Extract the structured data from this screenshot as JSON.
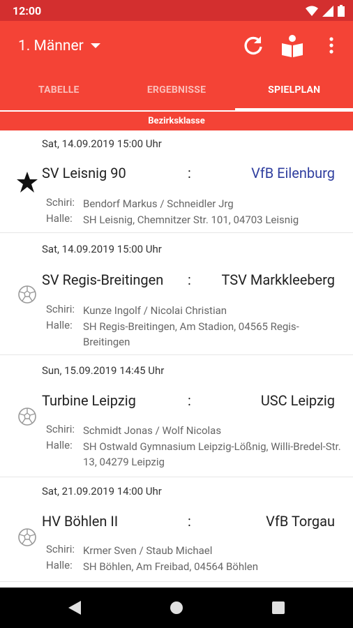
{
  "status": {
    "time": "12:00"
  },
  "app_bar": {
    "title": "1. Männer"
  },
  "tabs": [
    {
      "label": "TABELLE"
    },
    {
      "label": "ERGEBNISSE"
    },
    {
      "label": "SPIELPLAN"
    }
  ],
  "section": {
    "title": "Bezirksklasse"
  },
  "detail_labels": {
    "referee": "Schiri:",
    "hall": "Halle:"
  },
  "matches": [
    {
      "date": "Sat, 14.09.2019 15:00 Uhr",
      "icon": "star-icon",
      "home": "SV Leisnig 90",
      "sep": ":",
      "away": "VfB Eilenburg",
      "referee": "Bendorf Markus / Schneidler Jrg",
      "hall": "SH Leisnig, Chemnitzer Str. 101, 04703 Leisnig"
    },
    {
      "date": "Sat, 14.09.2019 15:00 Uhr",
      "icon": "handball-icon",
      "home": "SV Regis-Breitingen",
      "sep": ":",
      "away": "TSV Markkleeberg",
      "referee": "Kunze Ingolf / Nicolai Christian",
      "hall": "SH Regis-Breitingen, Am Stadion, 04565 Regis-Breitingen"
    },
    {
      "date": "Sun, 15.09.2019 14:45 Uhr",
      "icon": "handball-icon",
      "home": "Turbine Leipzig",
      "sep": ":",
      "away": "USC Leipzig",
      "referee": "Schmidt Jonas / Wolf Nicolas",
      "hall": "SH Ostwald Gymnasium Leipzig-Lößnig, Willi-Bredel-Str. 13, 04279 Leipzig"
    },
    {
      "date": "Sat, 21.09.2019 14:00 Uhr",
      "icon": "handball-icon",
      "home": "HV Böhlen II",
      "sep": ":",
      "away": "VfB Torgau",
      "referee": "Krmer Sven / Staub Michael",
      "hall": "SH Böhlen, Am Freibad, 04564 Böhlen"
    }
  ],
  "colors": {
    "primary": "#f44336",
    "status_bar": "#d32f2f",
    "highlight_team": "#303f9f"
  }
}
